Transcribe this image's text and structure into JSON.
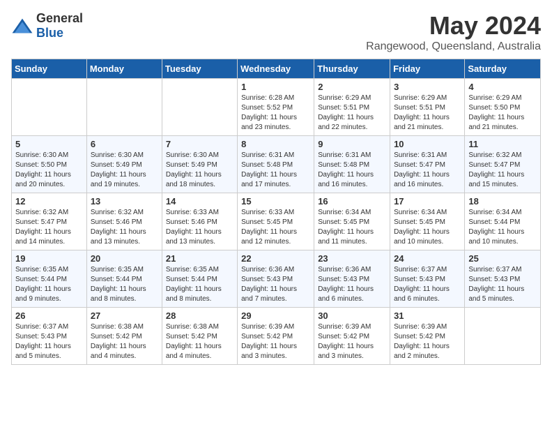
{
  "header": {
    "logo_general": "General",
    "logo_blue": "Blue",
    "month": "May 2024",
    "location": "Rangewood, Queensland, Australia"
  },
  "weekdays": [
    "Sunday",
    "Monday",
    "Tuesday",
    "Wednesday",
    "Thursday",
    "Friday",
    "Saturday"
  ],
  "weeks": [
    [
      {
        "day": "",
        "info": ""
      },
      {
        "day": "",
        "info": ""
      },
      {
        "day": "",
        "info": ""
      },
      {
        "day": "1",
        "info": "Sunrise: 6:28 AM\nSunset: 5:52 PM\nDaylight: 11 hours and 23 minutes."
      },
      {
        "day": "2",
        "info": "Sunrise: 6:29 AM\nSunset: 5:51 PM\nDaylight: 11 hours and 22 minutes."
      },
      {
        "day": "3",
        "info": "Sunrise: 6:29 AM\nSunset: 5:51 PM\nDaylight: 11 hours and 21 minutes."
      },
      {
        "day": "4",
        "info": "Sunrise: 6:29 AM\nSunset: 5:50 PM\nDaylight: 11 hours and 21 minutes."
      }
    ],
    [
      {
        "day": "5",
        "info": "Sunrise: 6:30 AM\nSunset: 5:50 PM\nDaylight: 11 hours and 20 minutes."
      },
      {
        "day": "6",
        "info": "Sunrise: 6:30 AM\nSunset: 5:49 PM\nDaylight: 11 hours and 19 minutes."
      },
      {
        "day": "7",
        "info": "Sunrise: 6:30 AM\nSunset: 5:49 PM\nDaylight: 11 hours and 18 minutes."
      },
      {
        "day": "8",
        "info": "Sunrise: 6:31 AM\nSunset: 5:48 PM\nDaylight: 11 hours and 17 minutes."
      },
      {
        "day": "9",
        "info": "Sunrise: 6:31 AM\nSunset: 5:48 PM\nDaylight: 11 hours and 16 minutes."
      },
      {
        "day": "10",
        "info": "Sunrise: 6:31 AM\nSunset: 5:47 PM\nDaylight: 11 hours and 16 minutes."
      },
      {
        "day": "11",
        "info": "Sunrise: 6:32 AM\nSunset: 5:47 PM\nDaylight: 11 hours and 15 minutes."
      }
    ],
    [
      {
        "day": "12",
        "info": "Sunrise: 6:32 AM\nSunset: 5:47 PM\nDaylight: 11 hours and 14 minutes."
      },
      {
        "day": "13",
        "info": "Sunrise: 6:32 AM\nSunset: 5:46 PM\nDaylight: 11 hours and 13 minutes."
      },
      {
        "day": "14",
        "info": "Sunrise: 6:33 AM\nSunset: 5:46 PM\nDaylight: 11 hours and 13 minutes."
      },
      {
        "day": "15",
        "info": "Sunrise: 6:33 AM\nSunset: 5:45 PM\nDaylight: 11 hours and 12 minutes."
      },
      {
        "day": "16",
        "info": "Sunrise: 6:34 AM\nSunset: 5:45 PM\nDaylight: 11 hours and 11 minutes."
      },
      {
        "day": "17",
        "info": "Sunrise: 6:34 AM\nSunset: 5:45 PM\nDaylight: 11 hours and 10 minutes."
      },
      {
        "day": "18",
        "info": "Sunrise: 6:34 AM\nSunset: 5:44 PM\nDaylight: 11 hours and 10 minutes."
      }
    ],
    [
      {
        "day": "19",
        "info": "Sunrise: 6:35 AM\nSunset: 5:44 PM\nDaylight: 11 hours and 9 minutes."
      },
      {
        "day": "20",
        "info": "Sunrise: 6:35 AM\nSunset: 5:44 PM\nDaylight: 11 hours and 8 minutes."
      },
      {
        "day": "21",
        "info": "Sunrise: 6:35 AM\nSunset: 5:44 PM\nDaylight: 11 hours and 8 minutes."
      },
      {
        "day": "22",
        "info": "Sunrise: 6:36 AM\nSunset: 5:43 PM\nDaylight: 11 hours and 7 minutes."
      },
      {
        "day": "23",
        "info": "Sunrise: 6:36 AM\nSunset: 5:43 PM\nDaylight: 11 hours and 6 minutes."
      },
      {
        "day": "24",
        "info": "Sunrise: 6:37 AM\nSunset: 5:43 PM\nDaylight: 11 hours and 6 minutes."
      },
      {
        "day": "25",
        "info": "Sunrise: 6:37 AM\nSunset: 5:43 PM\nDaylight: 11 hours and 5 minutes."
      }
    ],
    [
      {
        "day": "26",
        "info": "Sunrise: 6:37 AM\nSunset: 5:43 PM\nDaylight: 11 hours and 5 minutes."
      },
      {
        "day": "27",
        "info": "Sunrise: 6:38 AM\nSunset: 5:42 PM\nDaylight: 11 hours and 4 minutes."
      },
      {
        "day": "28",
        "info": "Sunrise: 6:38 AM\nSunset: 5:42 PM\nDaylight: 11 hours and 4 minutes."
      },
      {
        "day": "29",
        "info": "Sunrise: 6:39 AM\nSunset: 5:42 PM\nDaylight: 11 hours and 3 minutes."
      },
      {
        "day": "30",
        "info": "Sunrise: 6:39 AM\nSunset: 5:42 PM\nDaylight: 11 hours and 3 minutes."
      },
      {
        "day": "31",
        "info": "Sunrise: 6:39 AM\nSunset: 5:42 PM\nDaylight: 11 hours and 2 minutes."
      },
      {
        "day": "",
        "info": ""
      }
    ]
  ]
}
